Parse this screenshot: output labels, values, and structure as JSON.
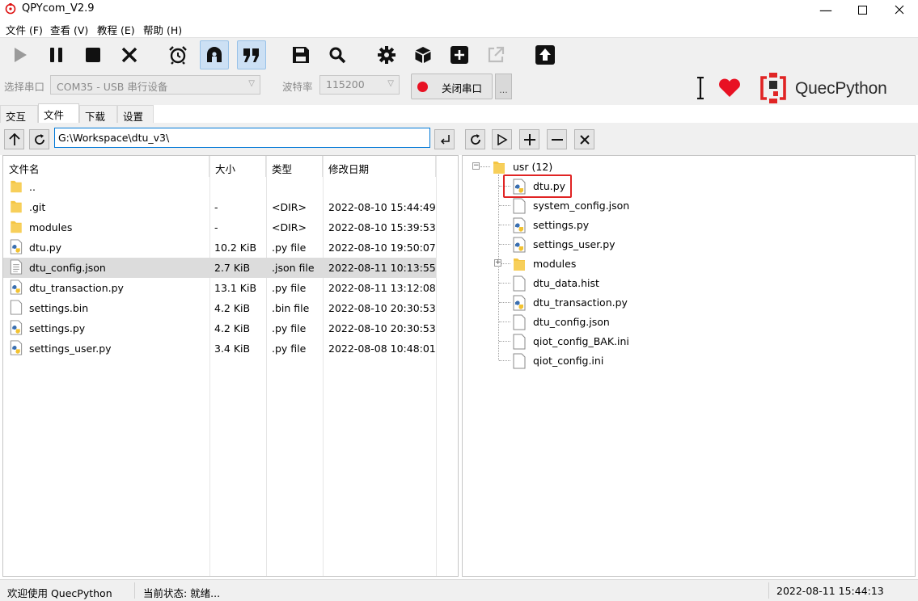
{
  "window": {
    "title": "QPYcom_V2.9",
    "minimize_glyph": "—",
    "maximize_glyph": "☐",
    "close_glyph": "✕"
  },
  "menu": [
    "文件 (F)",
    "查看 (V)",
    "教程 (E)",
    "帮助 (H)"
  ],
  "toolbar": {
    "buttons": [
      "play-icon",
      "pause-icon",
      "stop-icon",
      "close-x-icon",
      "alarm-clock-icon",
      "connect-icon",
      "quote-icon",
      "save-icon",
      "search-icon",
      "gear-icon",
      "package-icon",
      "add-icon",
      "external-link-icon",
      "upload-icon"
    ],
    "port_label": "选择串口",
    "port_value": "COM35 - USB 串行设备",
    "baud_label": "波特率",
    "baud_value": "115200",
    "close_port_label": "关闭串口",
    "more_label": "...",
    "logo_text": "QuecPython"
  },
  "tabs": [
    "交互",
    "文件",
    "下载",
    "设置"
  ],
  "active_tab": "文件",
  "local": {
    "path": "G:\\Workspace\\dtu_v3\\",
    "columns": [
      "文件名",
      "大小",
      "类型",
      "修改日期"
    ],
    "rows": [
      {
        "name": "..",
        "size": "",
        "type": "",
        "date": "",
        "icon": "folder-icon"
      },
      {
        "name": ".git",
        "size": "-",
        "type": "<DIR>",
        "date": "2022-08-10 15:44:49",
        "icon": "folder-icon"
      },
      {
        "name": "modules",
        "size": "-",
        "type": "<DIR>",
        "date": "2022-08-10 15:39:53",
        "icon": "folder-icon"
      },
      {
        "name": "dtu.py",
        "size": "10.2 KiB",
        "type": ".py file",
        "date": "2022-08-10 19:50:07",
        "icon": "python-file-icon"
      },
      {
        "name": "dtu_config.json",
        "size": "2.7 KiB",
        "type": ".json file",
        "date": "2022-08-11 10:13:55",
        "icon": "text-file-icon",
        "selected": true
      },
      {
        "name": "dtu_transaction.py",
        "size": "13.1 KiB",
        "type": ".py file",
        "date": "2022-08-11 13:12:08",
        "icon": "python-file-icon"
      },
      {
        "name": "settings.bin",
        "size": "4.2 KiB",
        "type": ".bin file",
        "date": "2022-08-10 20:30:53",
        "icon": "blank-file-icon"
      },
      {
        "name": "settings.py",
        "size": "4.2 KiB",
        "type": ".py file",
        "date": "2022-08-10 20:30:53",
        "icon": "python-file-icon"
      },
      {
        "name": "settings_user.py",
        "size": "3.4 KiB",
        "type": ".py file",
        "date": "2022-08-08 10:48:01",
        "icon": "python-file-icon"
      }
    ]
  },
  "device": {
    "root_label": "usr (12)",
    "items": [
      {
        "name": "dtu.py",
        "icon": "python-file-icon",
        "highlighted": true
      },
      {
        "name": "system_config.json",
        "icon": "blank-file-icon"
      },
      {
        "name": "settings.py",
        "icon": "python-file-icon"
      },
      {
        "name": "settings_user.py",
        "icon": "python-file-icon"
      },
      {
        "name": "modules",
        "icon": "folder-icon",
        "expandable": true
      },
      {
        "name": "dtu_data.hist",
        "icon": "blank-file-icon"
      },
      {
        "name": "dtu_transaction.py",
        "icon": "python-file-icon"
      },
      {
        "name": "dtu_config.json",
        "icon": "blank-file-icon"
      },
      {
        "name": "qiot_config_BAK.ini",
        "icon": "blank-file-icon"
      },
      {
        "name": "qiot_config.ini",
        "icon": "blank-file-icon"
      }
    ]
  },
  "status": {
    "welcome": "欢迎使用 QuecPython",
    "state": "当前状态: 就绪...",
    "datetime": "2022-08-11 15:44:13"
  },
  "colors": {
    "accent_red": "#e81123",
    "highlight_red": "#e02424",
    "active_button_bg": "#cce0f4",
    "folder_yellow": "#f4c542"
  }
}
